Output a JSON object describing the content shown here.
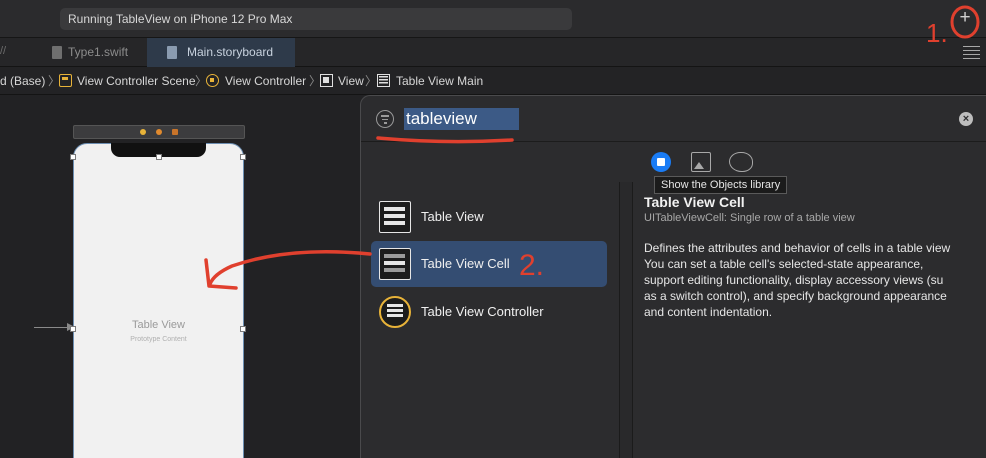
{
  "toolbar": {
    "status": "Running TableView on iPhone 12 Pro Max",
    "library_button": "+"
  },
  "tabs": {
    "fragment": "//",
    "items": [
      {
        "label": "Type1.swift",
        "active": false
      },
      {
        "label": "Main.storyboard",
        "active": true
      }
    ]
  },
  "jumpbar": {
    "items": [
      {
        "label": "d (Base)",
        "icon": "storyboard-icon"
      },
      {
        "label": "View Controller Scene",
        "icon": "scene-icon"
      },
      {
        "label": "View Controller",
        "icon": "view-controller-icon"
      },
      {
        "label": "View",
        "icon": "view-icon"
      },
      {
        "label": "Table View Main",
        "icon": "table-view-icon"
      }
    ]
  },
  "canvas": {
    "table_view_title": "Table View",
    "table_view_subtitle": "Prototype Content"
  },
  "library": {
    "search_value": "tableview",
    "clear_label": "×",
    "tooltip": "Show the Objects library",
    "items": [
      {
        "label": "Table View",
        "icon": "table-view-icon",
        "selected": false
      },
      {
        "label": "Table View Cell",
        "icon": "table-view-cell-icon",
        "selected": true
      },
      {
        "label": "Table View Controller",
        "icon": "table-view-controller-icon",
        "selected": false
      }
    ],
    "detail": {
      "title": "Table View Cell",
      "subtitle": "UITableViewCell: Single row of a table view",
      "description": "Defines the attributes and behavior of cells in a table view\nYou can set a table cell's selected-state appearance,\nsupport editing functionality, display accessory views (su\nas a switch control), and specify background appearance\nand content indentation."
    }
  },
  "annotations": {
    "step1": "1.",
    "step2": "2.",
    "color": "#e0402e"
  }
}
